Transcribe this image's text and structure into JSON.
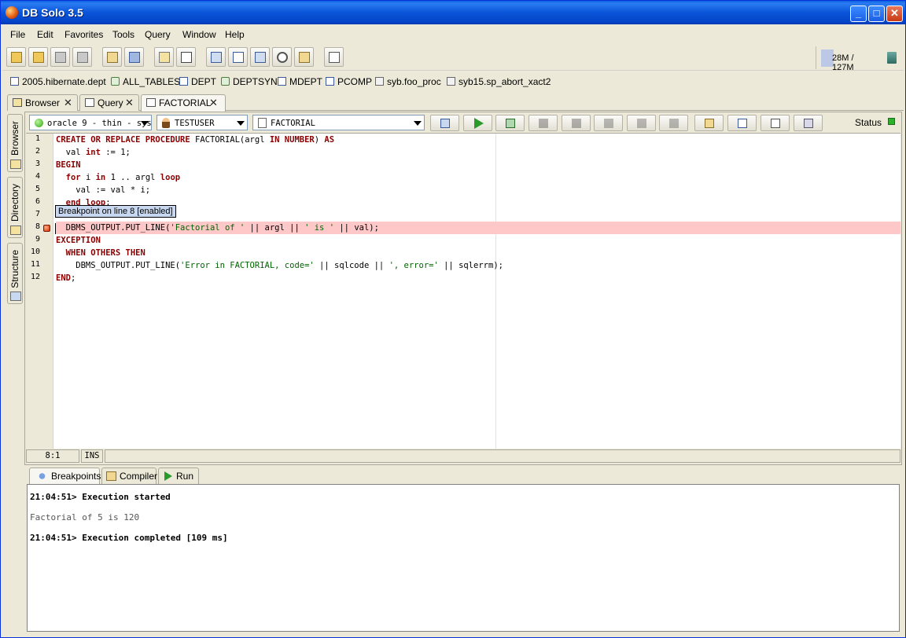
{
  "window": {
    "title": "DB Solo  3.5",
    "min": "_",
    "max": "□",
    "close": "✕"
  },
  "menu": [
    "File",
    "Edit",
    "Favorites",
    "Tools",
    "Query",
    "Window",
    "Help"
  ],
  "memory": {
    "text": "28M / 127M",
    "used_fraction": 0.22
  },
  "favorites": [
    {
      "label": "2005.hibernate.dept",
      "icon": "table-icon"
    },
    {
      "label": "ALL_TABLES",
      "icon": "synonym-icon"
    },
    {
      "label": "DEPT",
      "icon": "table-icon"
    },
    {
      "label": "DEPTSYN",
      "icon": "synonym-icon"
    },
    {
      "label": "MDEPT",
      "icon": "table-icon"
    },
    {
      "label": "PCOMP",
      "icon": "table-icon"
    },
    {
      "label": "syb.foo_proc",
      "icon": "procedure-icon"
    },
    {
      "label": "syb15.sp_abort_xact2",
      "icon": "procedure-icon"
    }
  ],
  "tabs": [
    {
      "label": "Browser",
      "close": "✕"
    },
    {
      "label": "Query",
      "close": "✕"
    },
    {
      "label": "FACTORIAL",
      "close": "✕"
    }
  ],
  "side_tabs": [
    "Browser",
    "Directory",
    "Structure"
  ],
  "editor": {
    "connection": "oracle 9 - thin - sys",
    "schema": "TESTUSER",
    "procedure": "FACTORIAL",
    "status_label": "Status",
    "status_color": "#2bb22b",
    "tooltip": "Breakpoint on line 8 [enabled]",
    "line_numbers": [
      "1",
      "2",
      "3",
      "4",
      "5",
      "6",
      "7",
      "8",
      "9",
      "10",
      "11",
      "12"
    ],
    "lines": [
      {
        "segments": [
          {
            "t": "CREATE OR REPLACE PROCEDURE",
            "c": "kw"
          },
          {
            "t": " FACTORIAL(argl ",
            "c": ""
          },
          {
            "t": "IN NUMBER",
            "c": "kw"
          },
          {
            "t": ") ",
            "c": ""
          },
          {
            "t": "AS",
            "c": "kw"
          }
        ]
      },
      {
        "segments": [
          {
            "t": "  val ",
            "c": ""
          },
          {
            "t": "int",
            "c": "kw"
          },
          {
            "t": " := 1;",
            "c": ""
          }
        ]
      },
      {
        "segments": [
          {
            "t": "BEGIN",
            "c": "kw"
          }
        ]
      },
      {
        "segments": [
          {
            "t": "  ",
            "c": ""
          },
          {
            "t": "for",
            "c": "kw"
          },
          {
            "t": " i ",
            "c": ""
          },
          {
            "t": "in",
            "c": "kw"
          },
          {
            "t": " 1 .. argl ",
            "c": ""
          },
          {
            "t": "loop",
            "c": "kw"
          }
        ]
      },
      {
        "segments": [
          {
            "t": "    val := val * i;",
            "c": ""
          }
        ]
      },
      {
        "segments": [
          {
            "t": "  ",
            "c": ""
          },
          {
            "t": "end loop",
            "c": "kw"
          },
          {
            "t": ";",
            "c": ""
          }
        ]
      },
      {
        "segments": [
          {
            "t": "",
            "c": ""
          }
        ]
      },
      {
        "segments": [
          {
            "t": "  DBMS_OUTPUT.PUT_LINE(",
            "c": ""
          },
          {
            "t": "'Factorial of '",
            "c": "str"
          },
          {
            "t": " || argl || ",
            "c": ""
          },
          {
            "t": "' is '",
            "c": "str"
          },
          {
            "t": " || val);",
            "c": ""
          }
        ]
      },
      {
        "segments": [
          {
            "t": "EXCEPTION",
            "c": "kw"
          }
        ]
      },
      {
        "segments": [
          {
            "t": "  ",
            "c": ""
          },
          {
            "t": "WHEN OTHERS THEN",
            "c": "kw"
          }
        ]
      },
      {
        "segments": [
          {
            "t": "    DBMS_OUTPUT.PUT_LINE(",
            "c": ""
          },
          {
            "t": "'Error in FACTORIAL, code='",
            "c": "str"
          },
          {
            "t": " || sqlcode || ",
            "c": ""
          },
          {
            "t": "', error='",
            "c": "str"
          },
          {
            "t": " || sqlerrm);",
            "c": ""
          }
        ]
      },
      {
        "segments": [
          {
            "t": "END",
            "c": "kw"
          },
          {
            "t": ";",
            "c": ""
          }
        ]
      }
    ],
    "breakpoint_line": 8,
    "cursor_pos": "8:1",
    "mode": "INS"
  },
  "bottom_tabs": [
    "Breakpoints",
    "Compiler",
    "Run"
  ],
  "output": [
    {
      "text": "21:04:51> Execution started",
      "style": "b"
    },
    {
      "text": "Factorial of 5 is 120",
      "style": "g"
    },
    {
      "text": "21:04:51> Execution completed [109 ms]",
      "style": "b"
    }
  ]
}
